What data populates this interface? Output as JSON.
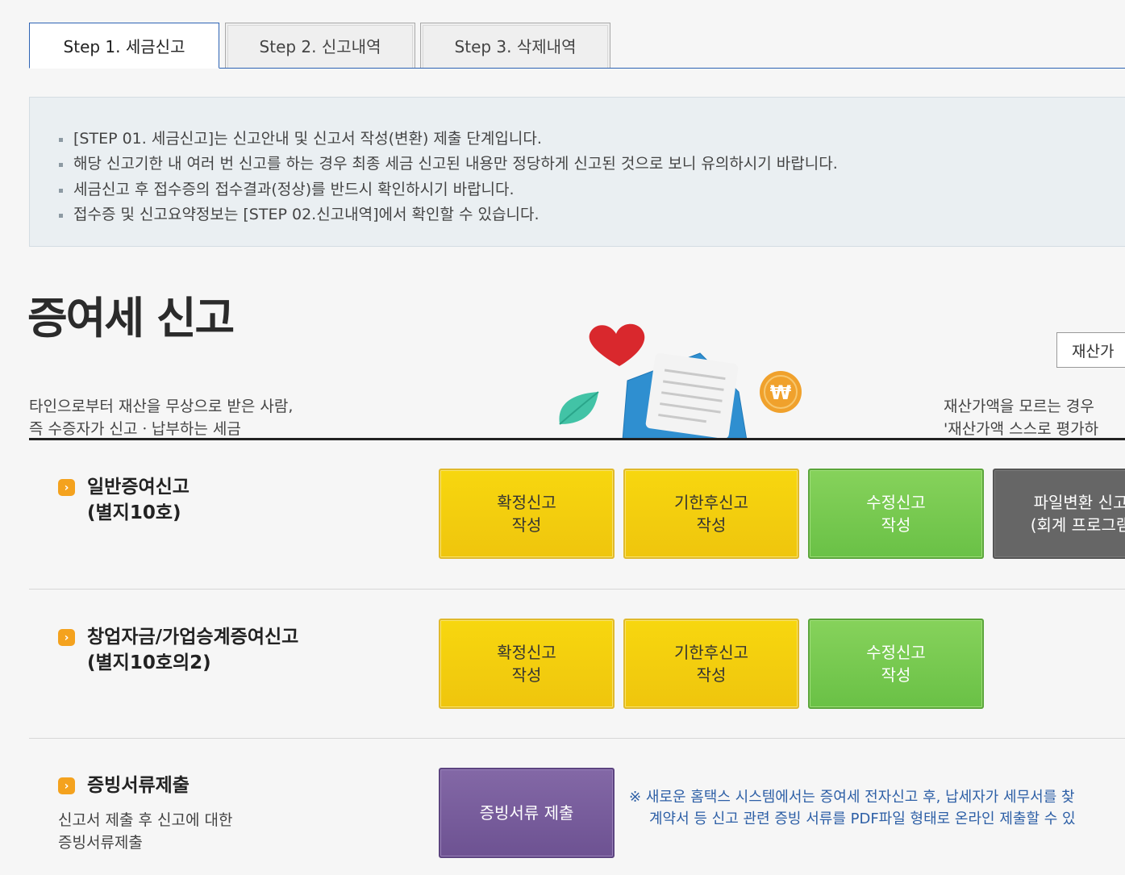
{
  "tabs": [
    {
      "label": "Step 1. 세금신고",
      "active": true
    },
    {
      "label": "Step 2. 신고내역",
      "active": false
    },
    {
      "label": "Step 3. 삭제내역",
      "active": false
    }
  ],
  "info": [
    "[STEP 01. 세금신고]는 신고안내 및 신고서 작성(변환) 제출 단계입니다.",
    "해당 신고기한 내 여러 번 신고를 하는 경우 최종 세금 신고된 내용만 정당하게 신고된 것으로 보니 유의하시기 바랍니다.",
    "세금신고 후 접수증의 접수결과(정상)를 반드시 확인하시기 바랍니다.",
    "접수증 및 신고요약정보는 [STEP 02.신고내역]에서 확인할 수 있습니다."
  ],
  "hero": {
    "title": "증여세 신고",
    "desc_left_1": "타인으로부터 재산을 무상으로 받은 사람,",
    "desc_left_2": "즉 수증자가 신고ㆍ납부하는 세금",
    "desc_right_1": "재산가액을 모르는 경우",
    "desc_right_2": "'재산가액 스스로 평가하",
    "eval_button": "재산가"
  },
  "sections": [
    {
      "title_1": "일반증여신고",
      "title_2": "(별지10호)",
      "buttons": [
        {
          "label": "확정신고\n작성",
          "color": "yellow"
        },
        {
          "label": "기한후신고\n작성",
          "color": "yellow"
        },
        {
          "label": "수정신고\n작성",
          "color": "green"
        },
        {
          "label": "파일변환 신고\n(회계 프로그램",
          "color": "gray"
        }
      ]
    },
    {
      "title_1": "창업자금/가업승계증여신고",
      "title_2": "(별지10호의2)",
      "buttons": [
        {
          "label": "확정신고\n작성",
          "color": "yellow"
        },
        {
          "label": "기한후신고\n작성",
          "color": "yellow"
        },
        {
          "label": "수정신고\n작성",
          "color": "green"
        }
      ]
    },
    {
      "title_1": "증빙서류제출",
      "sub_1": "신고서 제출 후 신고에 대한",
      "sub_2": "증빙서류제출",
      "buttons": [
        {
          "label": "증빙서류 제출",
          "color": "purple"
        }
      ],
      "note_mark": "※",
      "note_1": "새로운 홈택스 시스템에서는 증여세 전자신고 후, 납세자가 세무서를 찾",
      "note_2": "계약서 등 신고 관련 증빙 서류를 PDF파일 형태로 온라인 제출할 수 있"
    }
  ],
  "colors": {
    "tab_active_border": "#2d63b4",
    "yellow_button": "#f3cf0e",
    "green_button": "#78c951",
    "gray_button": "#666666",
    "purple_button": "#775c9c",
    "note_text": "#2d5fa6",
    "bullet": "#f4a21e"
  },
  "icons": [
    "heart-icon",
    "leaf-icon",
    "envelope-icon",
    "won-coin-icon",
    "arrow-bullet-icon"
  ]
}
